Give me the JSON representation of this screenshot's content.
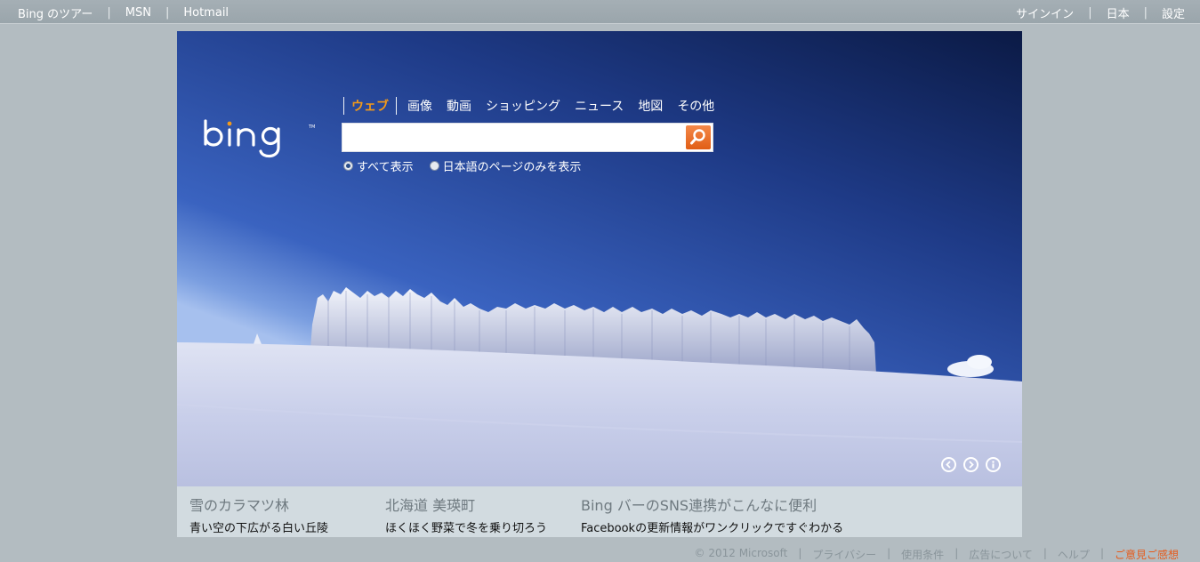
{
  "topbar": {
    "left": [
      "Bing のツアー",
      "MSN",
      "Hotmail"
    ],
    "right": [
      "サインイン",
      "日本",
      "設定"
    ]
  },
  "scopes": [
    "ウェブ",
    "画像",
    "動画",
    "ショッピング",
    "ニュース",
    "地図",
    "その他"
  ],
  "search": {
    "value": "",
    "placeholder": ""
  },
  "radios": [
    {
      "label": "すべて表示",
      "selected": true
    },
    {
      "label": "日本語のページのみを表示",
      "selected": false
    }
  ],
  "captions": [
    {
      "title": "雪のカラマツ林",
      "sub": "青い空の下広がる白い丘陵"
    },
    {
      "title": "北海道 美瑛町",
      "sub": "ほくほく野菜で冬を乗り切ろう"
    },
    {
      "title": "Bing バーのSNS連携がこんなに便利",
      "sub": "Facebookの更新情報がワンクリックですぐわかる"
    }
  ],
  "footer": {
    "copyright": "© 2012 Microsoft",
    "links": [
      "プライバシー",
      "使用条件",
      "広告について",
      "ヘルプ"
    ],
    "feedback": "ご意見ご感想"
  },
  "colors": {
    "accent": "#f29a1a",
    "search_button": "#e8661f",
    "feedback": "#e55b1c"
  }
}
